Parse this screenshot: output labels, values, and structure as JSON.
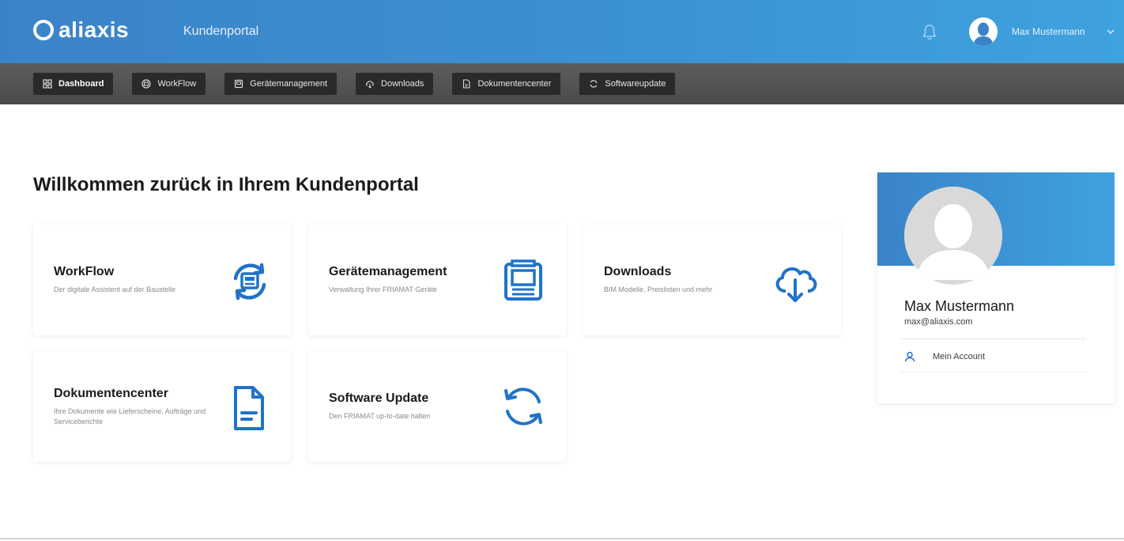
{
  "header": {
    "logo_text": "aliaxis",
    "portal_title": "Kundenportal",
    "user_name": "Max Mustermann"
  },
  "nav": {
    "items": [
      {
        "label": "Dashboard",
        "icon": "dashboard-icon"
      },
      {
        "label": "WorkFlow",
        "icon": "workflow-icon"
      },
      {
        "label": "Gerätemanagement",
        "icon": "device-icon"
      },
      {
        "label": "Downloads",
        "icon": "cloud-download-icon"
      },
      {
        "label": "Dokumentencenter",
        "icon": "document-icon"
      },
      {
        "label": "Softwareupdate",
        "icon": "refresh-icon"
      }
    ],
    "active": "Dashboard"
  },
  "main": {
    "welcome": "Willkommen zurück in Ihrem Kundenportal",
    "cards": [
      {
        "title": "WorkFlow",
        "desc": "Der digitale Assistent auf der Baustelle",
        "icon": "workflow-icon"
      },
      {
        "title": "Gerätemanagement",
        "desc": "Verwaltung Ihrer FRIAMAT Geräte",
        "icon": "device-icon"
      },
      {
        "title": "Downloads",
        "desc": "BIM Modelle, Preislisten und mehr",
        "icon": "cloud-download-icon"
      },
      {
        "title": "Dokumentencenter",
        "desc": "Ihre Dokumente wie Lieferscheine, Aufträge und Serviceberichte",
        "icon": "document-icon"
      },
      {
        "title": "Software Update",
        "desc": "Den FRIAMAT up-to-date halten",
        "icon": "refresh-icon"
      }
    ]
  },
  "profile": {
    "name": "Max Mustermann",
    "email": "max@aliaxis.com",
    "account_link": "Mein Account"
  },
  "colors": {
    "brand_blue": "#3b8fd2",
    "icon_blue": "#1f73c8",
    "nav_dark": "#4a4a4a"
  }
}
